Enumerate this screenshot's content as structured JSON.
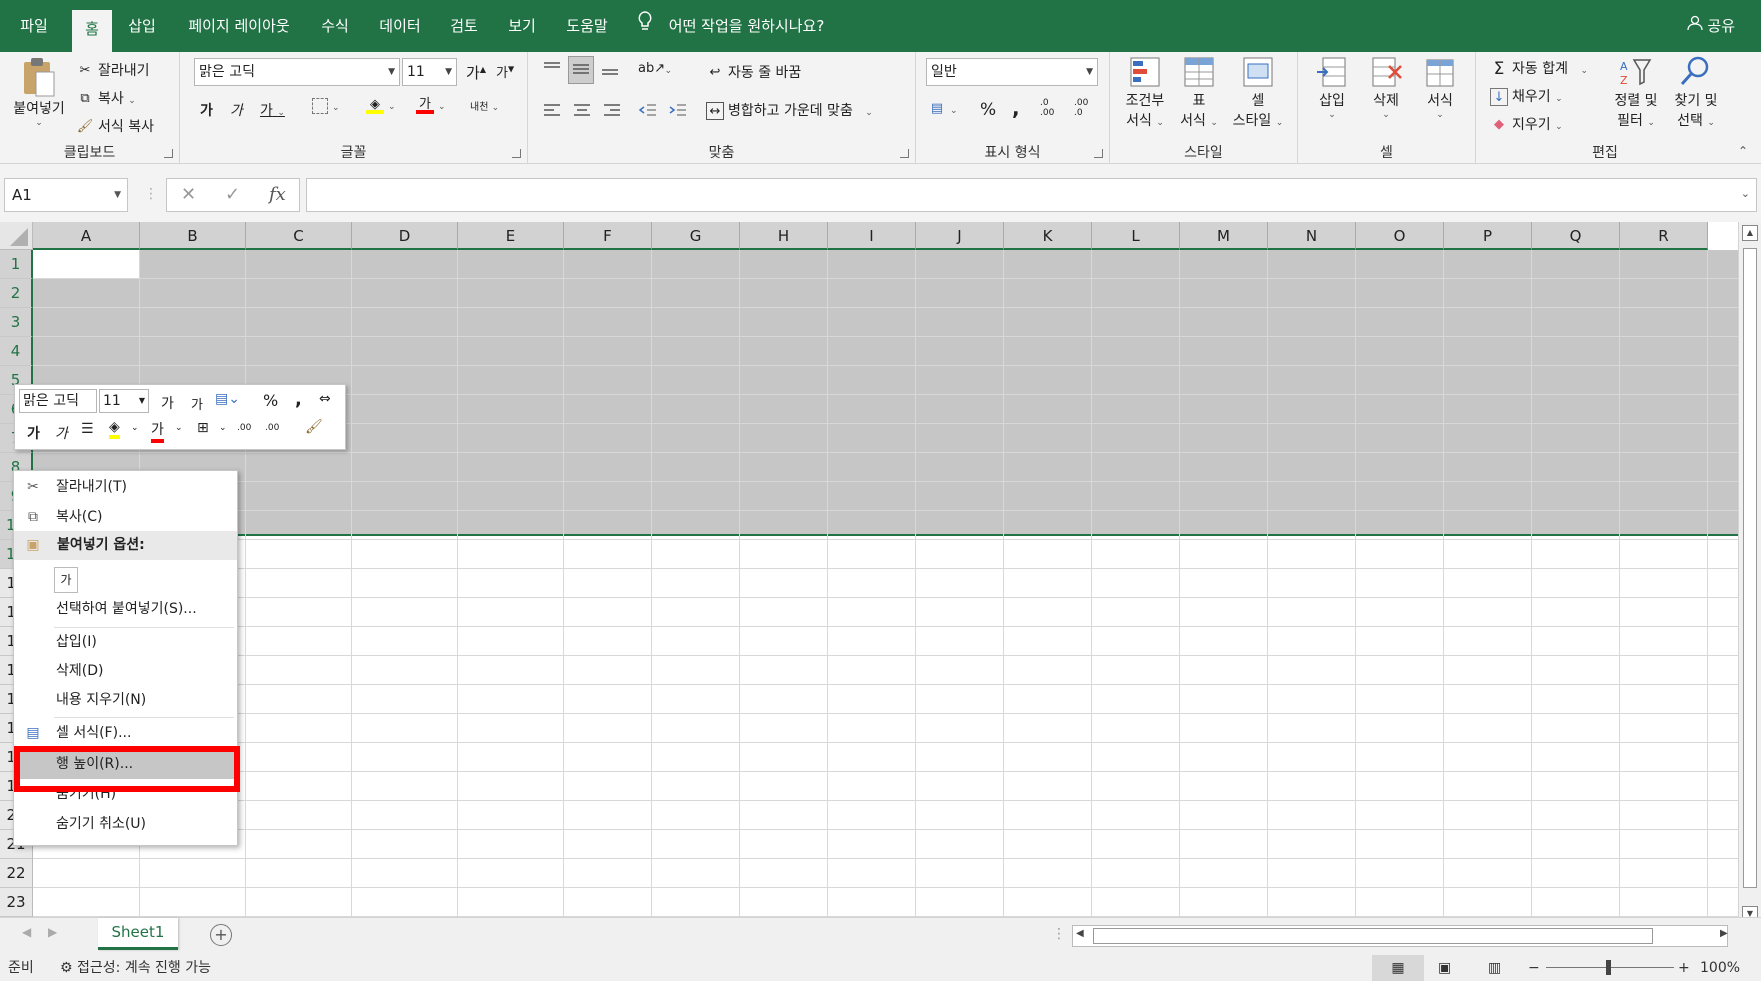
{
  "ribbon_tabs": [
    "파일",
    "홈",
    "삽입",
    "페이지 레이아웃",
    "수식",
    "데이터",
    "검토",
    "보기",
    "도움말"
  ],
  "tell_me": "어떤 작업을 원하시나요?",
  "share": "공유",
  "clipboard": {
    "paste": "붙여넣기",
    "cut": "잘라내기",
    "copy": "복사",
    "format_painter": "서식 복사",
    "label": "클립보드"
  },
  "font": {
    "name": "맑은 고딕",
    "size": "11",
    "label": "글꼴",
    "bold": "가",
    "italic": "가",
    "underline": "가",
    "grow": "가",
    "shrink": "가",
    "font_color": "가",
    "phonetic": "내천"
  },
  "alignment": {
    "wrap": "자동 줄 바꿈",
    "merge": "병합하고 가운데 맞춤",
    "label": "맞춤"
  },
  "number": {
    "format": "일반",
    "percent": "%",
    "comma": ",",
    "label": "표시 형식",
    "dec_up": ".0\n.00",
    "dec_down": ".00\n.0"
  },
  "styles": {
    "cond_1": "조건부",
    "cond_2": "서식",
    "table_1": "표",
    "table_2": "서식",
    "cell_1": "셀",
    "cell_2": "스타일",
    "label": "스타일"
  },
  "cells": {
    "insert": "삽입",
    "delete": "삭제",
    "format": "서식",
    "label": "셀"
  },
  "editing": {
    "autosum": "자동 합계",
    "fill": "채우기",
    "clear": "지우기",
    "sort_1": "정렬 및",
    "sort_2": "필터",
    "find_1": "찾기 및",
    "find_2": "선택",
    "label": "편집"
  },
  "name_box": "A1",
  "columns": [
    "A",
    "B",
    "C",
    "D",
    "E",
    "F",
    "G",
    "H",
    "I",
    "J",
    "K",
    "L",
    "M",
    "N",
    "O",
    "P",
    "Q",
    "R"
  ],
  "rows": [
    "1",
    "2",
    "3",
    "4",
    "5",
    "6",
    "7",
    "8",
    "9",
    "10",
    "11",
    "12",
    "13",
    "14",
    "15",
    "16",
    "17",
    "18",
    "19",
    "20",
    "21",
    "22",
    "23"
  ],
  "mini_toolbar": {
    "font": "맑은 고딕",
    "size": "11",
    "grow": "가",
    "shrink": "가",
    "percent": "%",
    "comma": ",",
    "bold": "가",
    "italic": "가",
    "color": "가",
    "dec_up": ".00",
    "dec_down": ".00"
  },
  "context_menu": {
    "cut": "잘라내기(T)",
    "copy": "복사(C)",
    "paste_options": "붙여넣기 옵션:",
    "paste_icon_label": "가",
    "paste_special": "선택하여 붙여넣기(S)...",
    "insert": "삽입(I)",
    "delete": "삭제(D)",
    "clear": "내용 지우기(N)",
    "format_cells": "셀 서식(F)...",
    "row_height": "행 높이(R)...",
    "hide": "숨기기(H)",
    "unhide": "숨기기 취소(U)"
  },
  "sheet_tab": "Sheet1",
  "status": {
    "ready": "준비",
    "accessibility": "접근성: 계속 진행 가능",
    "zoom": "100%"
  }
}
